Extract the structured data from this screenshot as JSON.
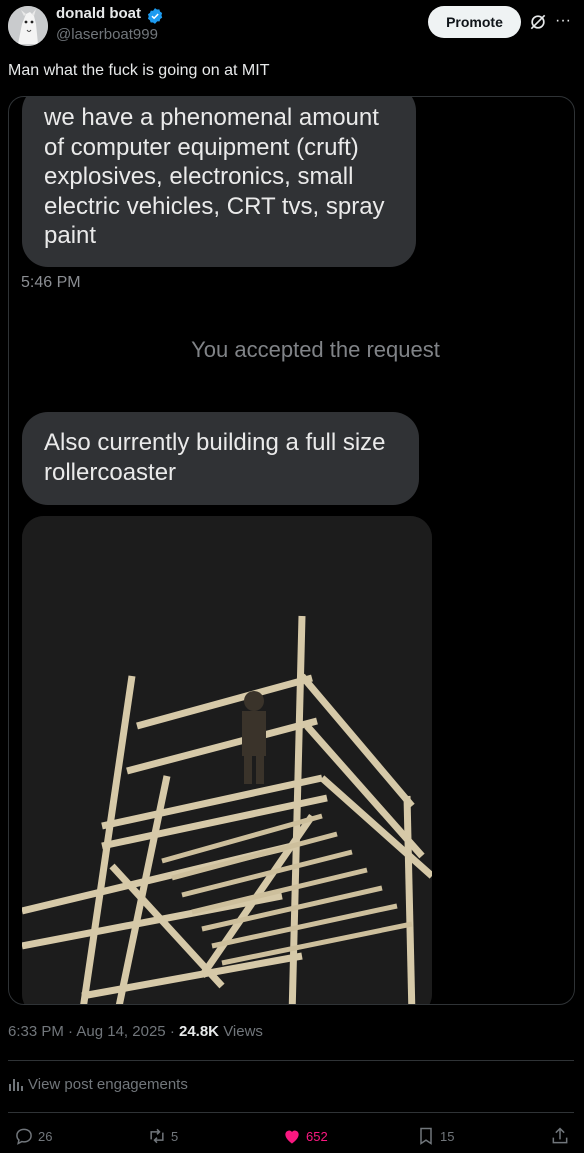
{
  "author": {
    "name": "donald boat",
    "handle": "@laserboat999"
  },
  "header": {
    "promote_label": "Promote",
    "more_icon": "more-icon",
    "grok_icon": "grok-icon"
  },
  "tweet": {
    "text": "Man what the fuck is going on at MIT"
  },
  "media": {
    "bubble1": "we have a phenomenal amount of computer equipment (cruft) explosives, electronics, small electric vehicles, CRT tvs, spray paint",
    "time1": "5:46 PM",
    "system_message": "You accepted the request",
    "bubble2": "Also currently building a full size rollercoaster"
  },
  "meta": {
    "time": "6:33 PM",
    "sep1": "·",
    "date": "Aug 14, 2025",
    "sep2": "·",
    "views_count": "24.8K",
    "views_label": "Views"
  },
  "engagements": {
    "label": "View post engagements"
  },
  "actions": {
    "replies": "26",
    "reposts": "5",
    "likes": "652",
    "bookmarks": "15"
  },
  "colors": {
    "background": "#000000",
    "bubble": "#303235",
    "like": "#f91880",
    "promote_bg": "#eff3f4",
    "verified": "#1d9bf0"
  }
}
